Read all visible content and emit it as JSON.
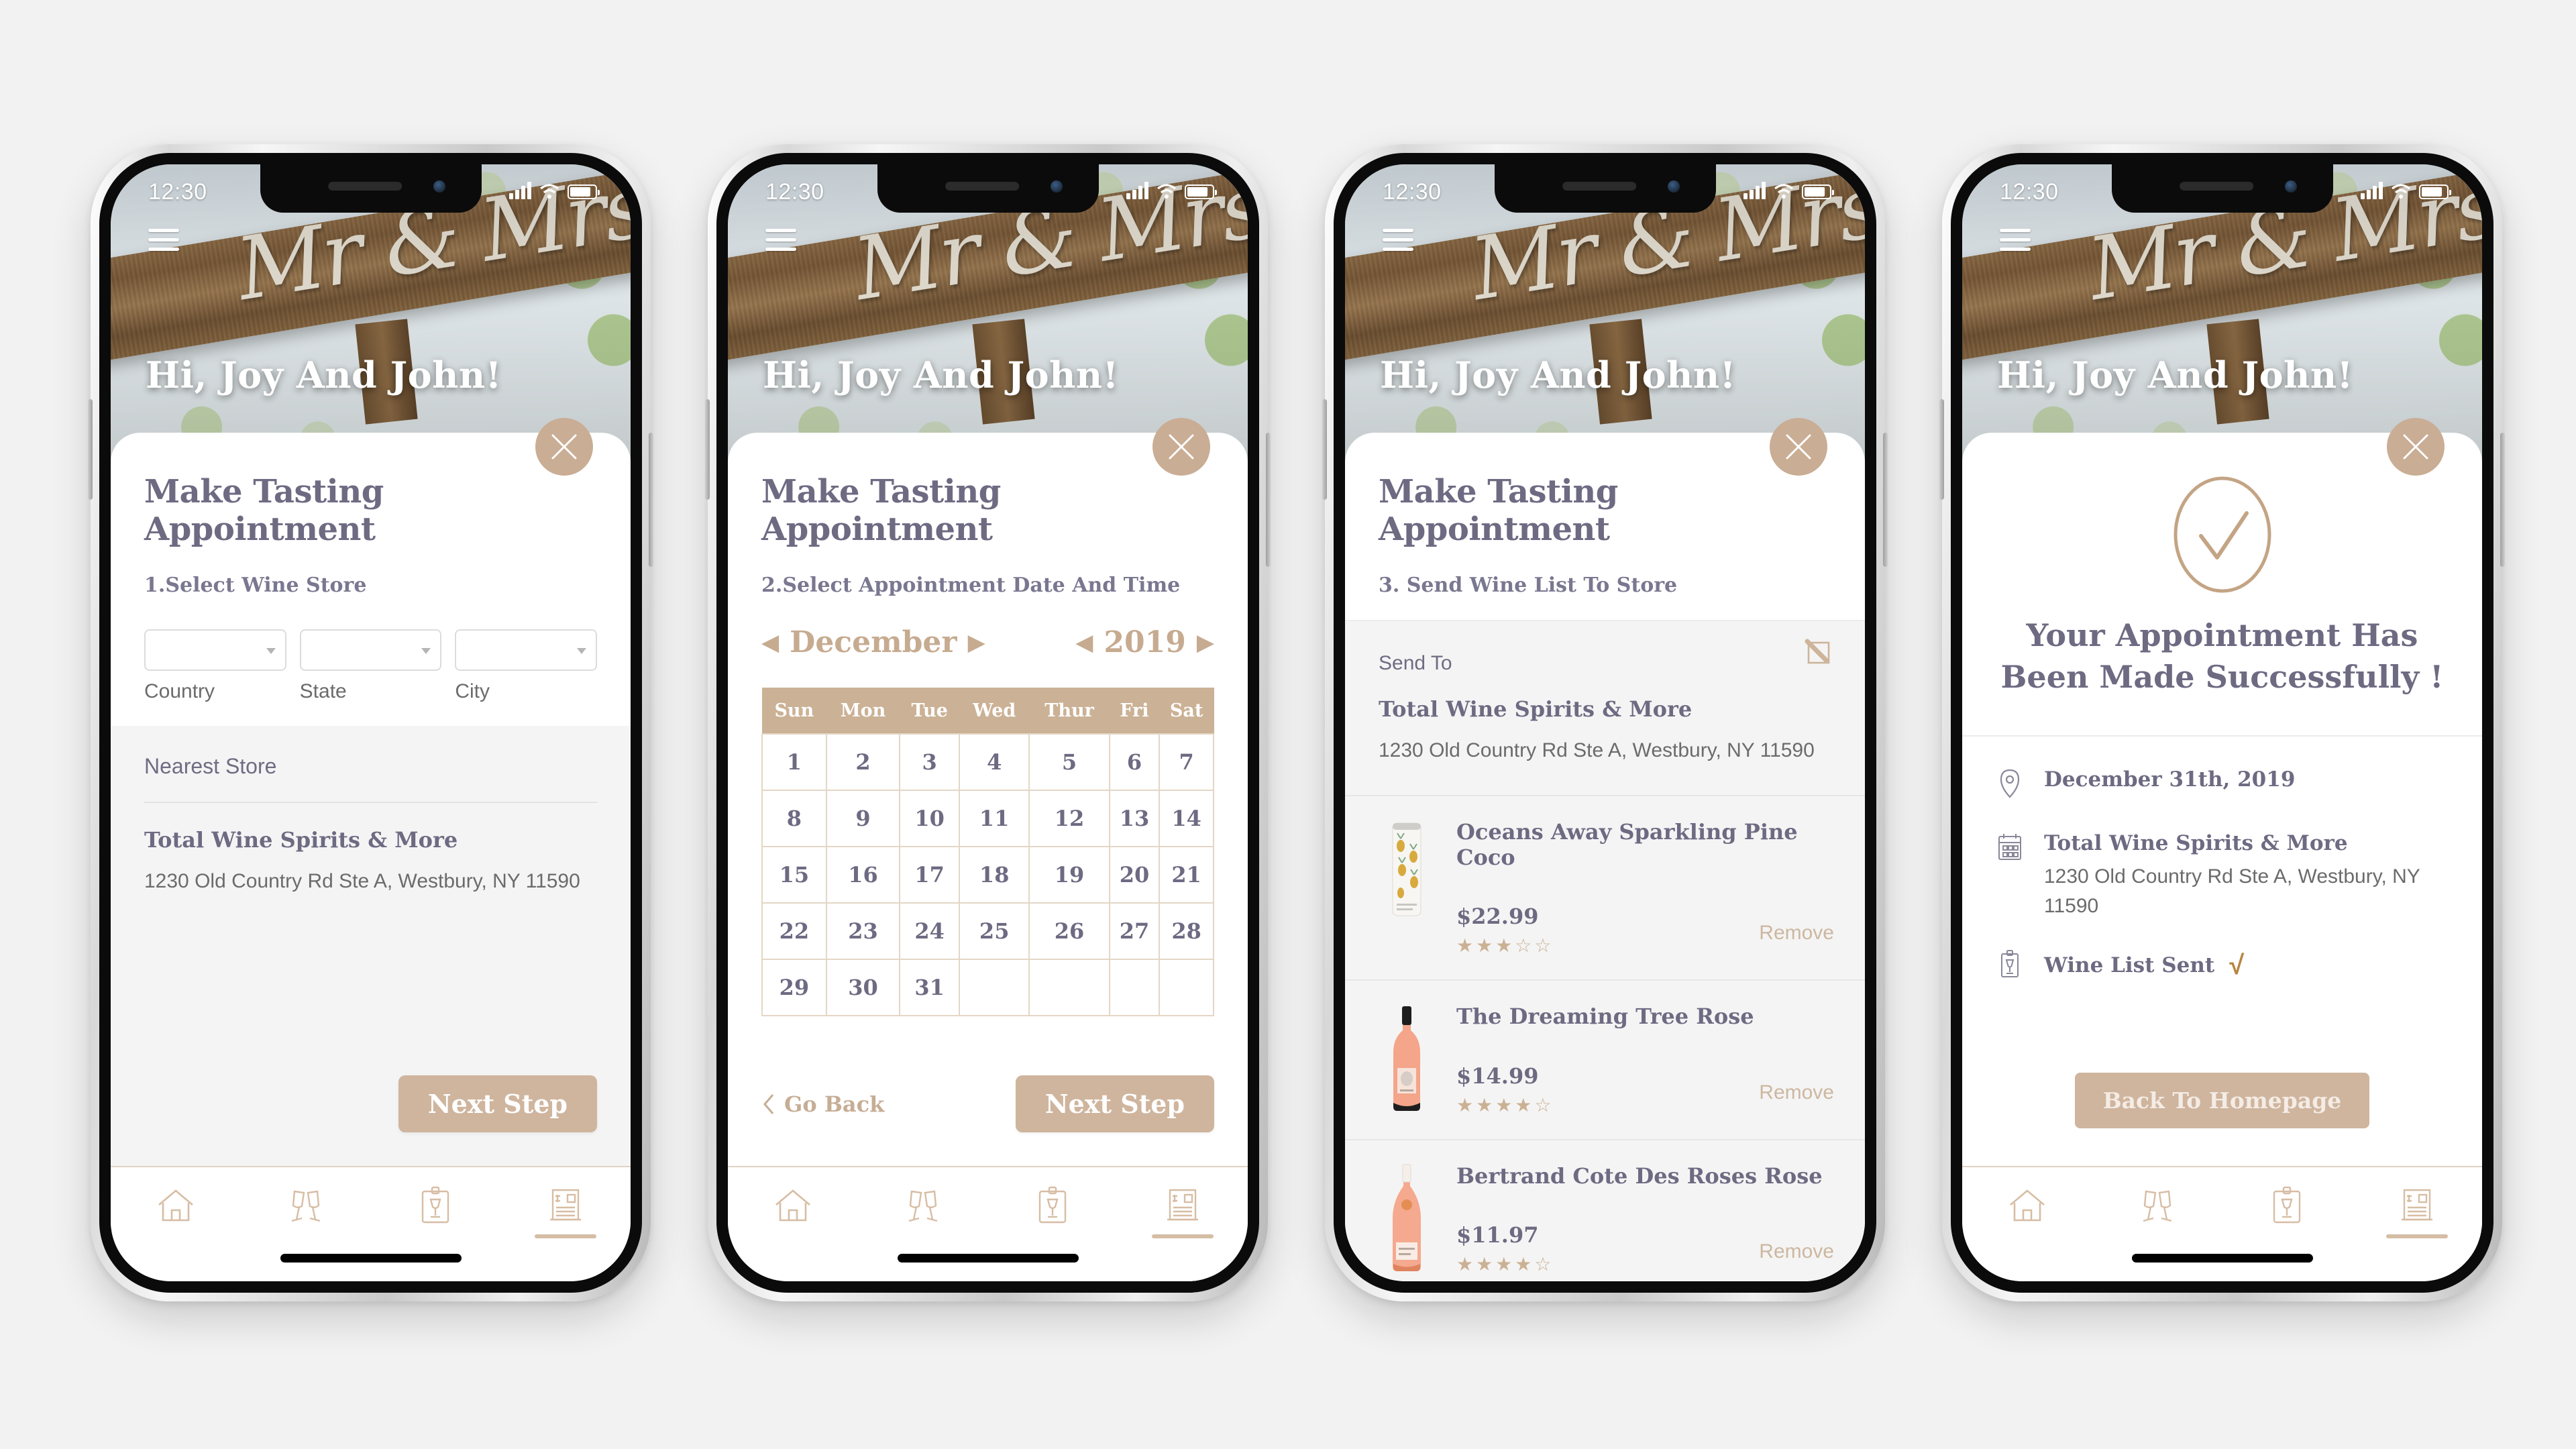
{
  "theme": {
    "accent": "#c9ad94",
    "accent_button": "#cfb59e",
    "heading_color": "#6d6a82",
    "calendar_header_bg": "#cbb195",
    "page_bg": "#f2f2f2"
  },
  "status_bar": {
    "time": "12:30",
    "signal_icon": "signal-bars-icon",
    "wifi_icon": "wifi-icon",
    "battery_icon": "battery-icon"
  },
  "header": {
    "menu_icon": "hamburger-menu-icon",
    "greeting": "Hi, Joy And John!",
    "close_icon": "close-icon",
    "hero_sign_text": "Mr & Mrs"
  },
  "screens": [
    {
      "id": "select-store",
      "title": "Make Tasting Appointment",
      "step_label": "1.Select Wine Store",
      "selects": [
        {
          "name": "country",
          "value": "",
          "label": "Country"
        },
        {
          "name": "state",
          "value": "",
          "label": "State"
        },
        {
          "name": "city",
          "value": "",
          "label": "City"
        }
      ],
      "nearest_store_label": "Nearest Store",
      "store_name": "Total Wine Spirits & More",
      "store_address": "1230 Old Country Rd Ste A, Westbury, NY 11590",
      "next_button": "Next Step"
    },
    {
      "id": "select-date",
      "title": "Make Tasting Appointment",
      "step_label": "2.Select Appointment Date And Time",
      "calendar": {
        "month": "December",
        "year": "2019",
        "prev_month_icon": "chevron-left-icon",
        "next_month_icon": "chevron-right-icon",
        "prev_year_icon": "chevron-left-icon",
        "next_year_icon": "chevron-right-icon",
        "weekdays": [
          "Sun",
          "Mon",
          "Tue",
          "Wed",
          "Thur",
          "Fri",
          "Sat"
        ],
        "weeks": [
          [
            "1",
            "2",
            "3",
            "4",
            "5",
            "6",
            "7"
          ],
          [
            "8",
            "9",
            "10",
            "11",
            "12",
            "13",
            "14"
          ],
          [
            "15",
            "16",
            "17",
            "18",
            "19",
            "20",
            "21"
          ],
          [
            "22",
            "23",
            "24",
            "25",
            "26",
            "27",
            "28"
          ],
          [
            "29",
            "30",
            "31",
            "",
            "",
            "",
            ""
          ]
        ]
      },
      "go_back_label": "Go Back",
      "next_button": "Next Step"
    },
    {
      "id": "send-wine-list",
      "title": "Make Tasting Appointment",
      "step_label": "3. Send Wine List To Store",
      "edit_icon": "edit-pencil-icon",
      "send_to_label": "Send To",
      "store_name": "Total Wine Spirits & More",
      "store_address": "1230 Old Country Rd Ste A, Westbury, NY 11590",
      "wines": [
        {
          "name": "Oceans Away Sparkling Pine Coco",
          "price": "$22.99",
          "rating": 3,
          "max_rating": 5,
          "remove_label": "Remove",
          "image": "pineapple-can-icon"
        },
        {
          "name": "The Dreaming Tree Rose",
          "price": "$14.99",
          "rating": 4,
          "max_rating": 5,
          "remove_label": "Remove",
          "image": "rose-bottle-icon"
        },
        {
          "name": "Bertrand Cote Des Roses Rose",
          "price": "$11.97",
          "rating": 4,
          "max_rating": 5,
          "remove_label": "Remove",
          "image": "rose-bottle-icon"
        }
      ]
    },
    {
      "id": "confirmation",
      "check_icon": "check-circle-icon",
      "success_line1": "Your Appointment Has",
      "success_line2": "Been Made Successfully !",
      "details": [
        {
          "icon": "location-pin-icon",
          "primary": "December 31th, 2019",
          "secondary": ""
        },
        {
          "icon": "calendar-icon",
          "primary": "Total Wine Spirits & More",
          "secondary": "1230 Old Country Rd Ste A, Westbury, NY 11590"
        },
        {
          "icon": "wine-clipboard-icon",
          "primary": "Wine List Sent",
          "secondary": "",
          "check_mark": "√"
        }
      ],
      "back_button": "Back To Homepage"
    }
  ],
  "bottom_nav": [
    {
      "name": "home",
      "icon": "home-icon",
      "active": false
    },
    {
      "name": "tasting",
      "icon": "cheers-glasses-icon",
      "active": false
    },
    {
      "name": "wine-list",
      "icon": "wine-clipboard-icon",
      "active": false
    },
    {
      "name": "billing",
      "icon": "receipt-invoice-icon",
      "active": true
    }
  ]
}
